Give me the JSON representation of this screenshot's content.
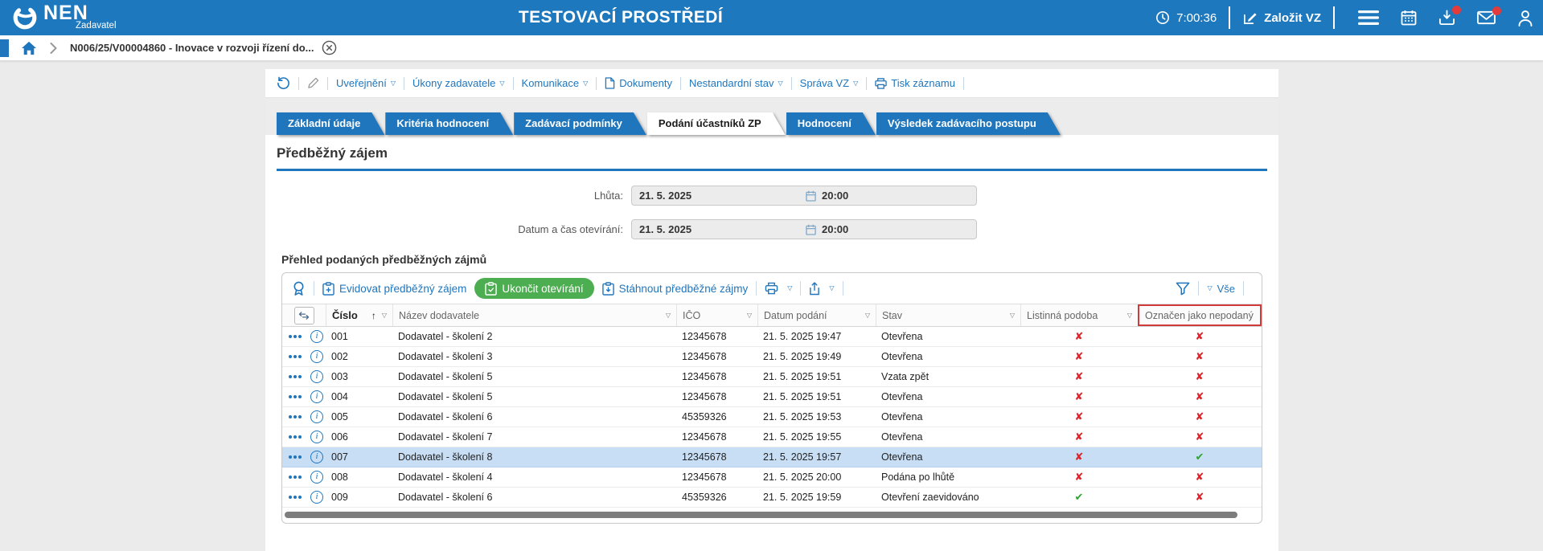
{
  "colors": {
    "header_blue": "#1d78bd",
    "accent": "#2076bc",
    "green_button": "#4cae50",
    "cross_red": "#d9252b",
    "check_green": "#2ca52c",
    "selected_row": "#c8def5",
    "highlight_box_red": "#cf3b3b"
  },
  "symbols": {
    "yes": "✔",
    "no": "✘"
  },
  "topbar": {
    "logo_text": "NEN",
    "logo_subtitle": "Zadavatel",
    "environment": "TESTOVACÍ PROSTŘEDÍ",
    "time": "7:00:36",
    "create_vz": "Založit VZ"
  },
  "breadcrumb": {
    "record": "N006/25/V00004860 - Inovace v rozvoji řízení do..."
  },
  "actionbar": {
    "items": [
      {
        "label": "Uveřejnění",
        "dropdown": true
      },
      {
        "label": "Úkony zadavatele",
        "dropdown": true
      },
      {
        "label": "Komunikace",
        "dropdown": true
      },
      {
        "label": "Dokumenty",
        "icon": "document"
      },
      {
        "label": "Nestandardní stav",
        "dropdown": true
      },
      {
        "label": "Správa VZ",
        "dropdown": true
      },
      {
        "label": "Tisk záznamu",
        "icon": "printer"
      }
    ]
  },
  "tabs": [
    {
      "label": "Základní údaje"
    },
    {
      "label": "Kritéria hodnocení"
    },
    {
      "label": "Zadávací podmínky"
    },
    {
      "label": "Podání účastníků ZP",
      "active": true
    },
    {
      "label": "Hodnocení"
    },
    {
      "label": "Výsledek zadávacího postupu"
    }
  ],
  "section": {
    "title": "Předběžný zájem"
  },
  "form": {
    "rows": [
      {
        "label": "Lhůta:",
        "date": "21. 5. 2025",
        "time": "20:00"
      },
      {
        "label": "Datum a čas otevírání:",
        "date": "21. 5. 2025",
        "time": "20:00"
      }
    ]
  },
  "grid": {
    "title": "Přehled podaných předběžných zájmů",
    "toolbar": {
      "register": "Evidovat předběžný zájem",
      "finish": "Ukončit otevírání",
      "download": "Stáhnout předběžné zájmy",
      "filter_all": "Vše"
    },
    "columns": [
      {
        "label": "Číslo",
        "bold": true,
        "sort": true,
        "filter": true
      },
      {
        "label": "Název dodavatele",
        "filter": true
      },
      {
        "label": "IČO",
        "filter": true
      },
      {
        "label": "Datum podání",
        "filter": true
      },
      {
        "label": "Stav",
        "filter": true
      },
      {
        "label": "Listinná podoba",
        "filter": true
      },
      {
        "label": "Označen jako nepodaný",
        "boxed": true
      }
    ],
    "rows": [
      {
        "cislo": "001",
        "nazev": "Dodavatel - školení 2",
        "ico": "12345678",
        "datum": "21. 5. 2025 19:47",
        "stav": "Otevřena",
        "listinna": "no",
        "nepodany": "no"
      },
      {
        "cislo": "002",
        "nazev": "Dodavatel - školení 3",
        "ico": "12345678",
        "datum": "21. 5. 2025 19:49",
        "stav": "Otevřena",
        "listinna": "no",
        "nepodany": "no"
      },
      {
        "cislo": "003",
        "nazev": "Dodavatel - školení 5",
        "ico": "12345678",
        "datum": "21. 5. 2025 19:51",
        "stav": "Vzata zpět",
        "listinna": "no",
        "nepodany": "no"
      },
      {
        "cislo": "004",
        "nazev": "Dodavatel - školení 5",
        "ico": "12345678",
        "datum": "21. 5. 2025 19:51",
        "stav": "Otevřena",
        "listinna": "no",
        "nepodany": "no"
      },
      {
        "cislo": "005",
        "nazev": "Dodavatel - školení 6",
        "ico": "45359326",
        "datum": "21. 5. 2025 19:53",
        "stav": "Otevřena",
        "listinna": "no",
        "nepodany": "no"
      },
      {
        "cislo": "006",
        "nazev": "Dodavatel - školení 7",
        "ico": "12345678",
        "datum": "21. 5. 2025 19:55",
        "stav": "Otevřena",
        "listinna": "no",
        "nepodany": "no"
      },
      {
        "cislo": "007",
        "nazev": "Dodavatel - školení 8",
        "ico": "12345678",
        "datum": "21. 5. 2025 19:57",
        "stav": "Otevřena",
        "listinna": "no",
        "nepodany": "yes",
        "selected": true
      },
      {
        "cislo": "008",
        "nazev": "Dodavatel - školení 4",
        "ico": "12345678",
        "datum": "21. 5. 2025 20:00",
        "stav": "Podána po lhůtě",
        "listinna": "no",
        "nepodany": "no"
      },
      {
        "cislo": "009",
        "nazev": "Dodavatel - školení 6",
        "ico": "45359326",
        "datum": "21. 5. 2025 19:59",
        "stav": "Otevření zaevidováno",
        "listinna": "yes",
        "nepodany": "no"
      }
    ]
  }
}
